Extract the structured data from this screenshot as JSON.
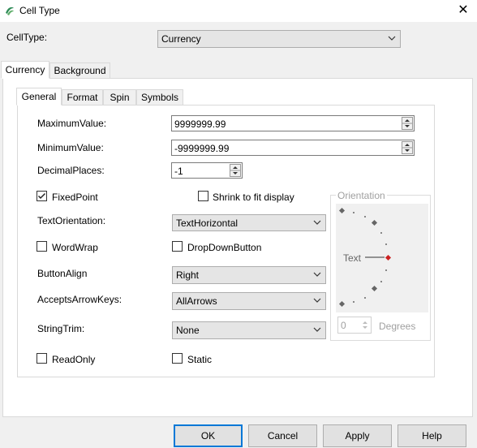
{
  "window": {
    "title": "Cell Type",
    "close_glyph": "✕"
  },
  "celltype": {
    "label": "CellType:",
    "value": "Currency"
  },
  "outer_tabs": [
    {
      "label": "Currency",
      "selected": true
    },
    {
      "label": "Background",
      "selected": false
    }
  ],
  "inner_tabs": [
    {
      "label": "General",
      "selected": true
    },
    {
      "label": "Format",
      "selected": false
    },
    {
      "label": "Spin",
      "selected": false
    },
    {
      "label": "Symbols",
      "selected": false
    }
  ],
  "general": {
    "max_label": "MaximumValue:",
    "max_value": "9999999.99",
    "min_label": "MinimumValue:",
    "min_value": "-9999999.99",
    "dec_label": "DecimalPlaces:",
    "dec_value": "-1",
    "fixedpoint_label": "FixedPoint",
    "fixedpoint_checked": true,
    "shrink_label": "Shrink to fit display",
    "shrink_checked": false,
    "orient_label": "TextOrientation:",
    "orient_value": "TextHorizontal",
    "wordwrap_label": "WordWrap",
    "wordwrap_checked": false,
    "dropdown_label": "DropDownButton",
    "dropdown_checked": false,
    "btnalign_label": "ButtonAlign",
    "btnalign_value": "Right",
    "arrowkeys_label": "AcceptsArrowKeys:",
    "arrowkeys_value": "AllArrows",
    "trim_label": "StringTrim:",
    "trim_value": "None",
    "readonly_label": "ReadOnly",
    "readonly_checked": false,
    "static_label": "Static",
    "static_checked": false
  },
  "orientation": {
    "title": "Orientation",
    "text": "Text",
    "degrees_value": "0",
    "degrees_label": "Degrees"
  },
  "buttons": {
    "ok": "OK",
    "cancel": "Cancel",
    "apply": "Apply",
    "help": "Help"
  },
  "colors": {
    "accent": "#0078d7",
    "orient_dot_selected": "#cc2222",
    "icon_green": "#2e8b57"
  }
}
